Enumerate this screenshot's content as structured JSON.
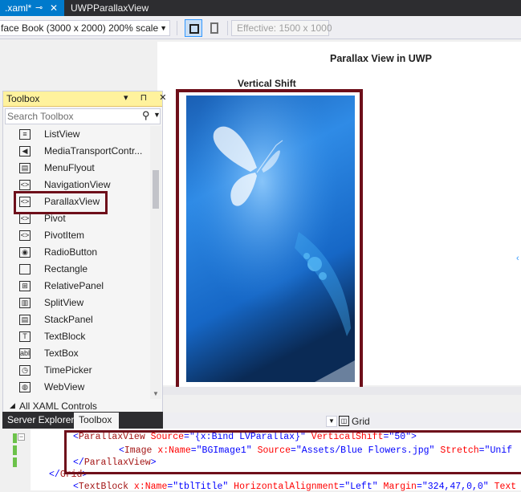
{
  "tabs": {
    "active": {
      "label": ".xaml*",
      "pin": "⊸",
      "close": "✕"
    },
    "second": {
      "label": "UWPParallaxView"
    }
  },
  "toolbar": {
    "device": "face Book (3000 x 2000) 200% scale",
    "effective": "Effective: 1500 x 1000"
  },
  "designer": {
    "page_title": "Parallax View in UWP",
    "vertical_shift_label": "Vertical Shift",
    "image_name": "Blue Flowers"
  },
  "toolbox": {
    "title": "Toolbox",
    "header_buttons": "▾ ⊓ ✕",
    "search_placeholder": "Search Toolbox",
    "items": [
      {
        "label": "ListView",
        "icon": "≡"
      },
      {
        "label": "MediaTransportContr...",
        "icon": "◀"
      },
      {
        "label": "MenuFlyout",
        "icon": "▤"
      },
      {
        "label": "NavigationView",
        "icon": "<>"
      },
      {
        "label": "ParallaxView",
        "icon": "<>"
      },
      {
        "label": "Pivot",
        "icon": "<>"
      },
      {
        "label": "PivotItem",
        "icon": "<>"
      },
      {
        "label": "RadioButton",
        "icon": "◉"
      },
      {
        "label": "Rectangle",
        "icon": ""
      },
      {
        "label": "RelativePanel",
        "icon": "⊞"
      },
      {
        "label": "SplitView",
        "icon": "▥"
      },
      {
        "label": "StackPanel",
        "icon": "▤"
      },
      {
        "label": "TextBlock",
        "icon": "T"
      },
      {
        "label": "TextBox",
        "icon": "abl"
      },
      {
        "label": "TimePicker",
        "icon": "◷"
      },
      {
        "label": "WebView",
        "icon": "◍"
      }
    ],
    "group": "All XAML Controls"
  },
  "bottom_tabs": {
    "server_explorer": "Server Explorer",
    "toolbox": "Toolbox"
  },
  "xaml_header": {
    "scope": "Grid"
  },
  "code": {
    "line1": {
      "open": "<",
      "tag": "ParallaxView",
      "a1": " Source",
      "eq1": "=\"",
      "v1": "{x:Bind LVParallax}",
      "q1": "\"",
      "a2": " VerticalShift",
      "eq2": "=\"",
      "v2": "50",
      "q2": "\">"
    },
    "line2": {
      "open": "<",
      "tag": "Image",
      "a1": " x:Name",
      "eq1": "=\"",
      "v1": "BGImage1",
      "q1": "\"",
      "a2": " Source",
      "eq2": "=\"",
      "v2": "Assets/Blue Flowers.jpg",
      "q2": "\"",
      "a3": " Stretch",
      "eq3": "=\"",
      "v3": "Unif"
    },
    "line3": {
      "open": "</",
      "tag": "ParallaxView",
      "close": ">"
    },
    "line4": {
      "open": "</",
      "tag": "Grid",
      "close": ">"
    },
    "line5": {
      "open": "<",
      "tag": "TextBlock",
      "a1": " x:Name",
      "eq1": "=\"",
      "v1": "tblTitle",
      "q1": "\"",
      "a2": " HorizontalAlignment",
      "eq2": "=\"",
      "v2": "Left",
      "q2": "\"",
      "a3": " Margin",
      "eq3": "=\"",
      "v3": "324,47,0,0",
      "q3": "\"",
      "a4": " Text"
    }
  },
  "colors": {
    "accent": "#007acc",
    "highlight_frame": "#6e0f1a",
    "toolbox_header": "#fff29d"
  }
}
